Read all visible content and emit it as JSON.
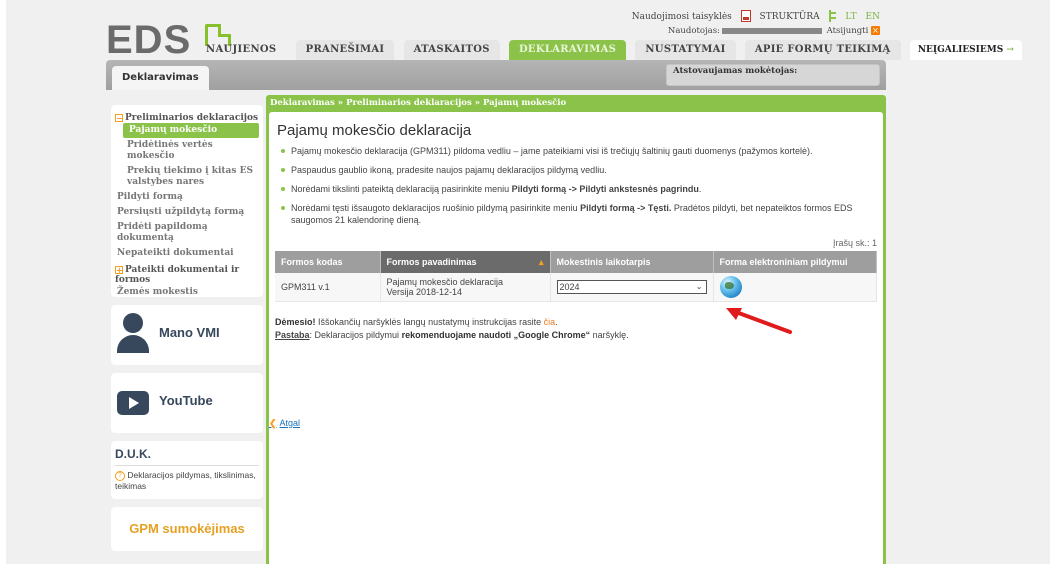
{
  "header": {
    "logo": "EDS",
    "top_links": {
      "rules": "Naudojimosi taisyklės",
      "structure": "STRUKTŪRA",
      "lang_lt": "LT",
      "lang_en": "EN"
    },
    "user_label": "Naudotojas:",
    "logout": "Atsijungti"
  },
  "nav": {
    "items": [
      "NAUJIENOS",
      "PRANEŠIMAI",
      "ATASKAITOS",
      "DEKLARAVIMAS",
      "NUSTATYMAI",
      "APIE FORMŲ TEIKIMĄ"
    ],
    "accessibility": "NEĮGALIESIEMS",
    "subtab": "Deklaravimas",
    "agent_label": "Atstovaujamas mokėtojas:"
  },
  "sidebar": {
    "group1": "Preliminarios deklaracijos",
    "group1_items": [
      "Pajamų mokesčio",
      "Pridėtinės vertės mokesčio",
      "Prekių tiekimo į kitas ES valstybes nares"
    ],
    "items": [
      "Pildyti formą",
      "Persiųsti užpildytą formą",
      "Pridėti papildomą dokumentą",
      "Nepateikti dokumentai"
    ],
    "group2": "Pateikti dokumentai ir formos",
    "item_last": "Žemės mokestis",
    "mano_vmi": "Mano VMI",
    "youtube": "YouTube",
    "duk_title": "D.U.K.",
    "duk_link": "Deklaracijos pildymas, tikslinimas, teikimas",
    "gpm": "GPM sumokėjimas"
  },
  "main": {
    "breadcrumb": "Deklaravimas » Preliminarios deklaracijos » Pajamų mokesčio",
    "title": "Pajamų mokesčio deklaracija",
    "bullets": {
      "b1": "Pajamų mokesčio deklaracija (GPM311) pildoma vedliu – jame pateikiami visi iš trečiųjų šaltinių gauti duomenys (pažymos kortelė).",
      "b2": "Paspaudus gaublio ikoną, pradesite naujos pajamų deklaracijos pildymą vedliu.",
      "b3_pre": "Norėdami tikslinti pateiktą deklaraciją pasirinkite meniu ",
      "b3_bold": "Pildyti formą -> Pildyti ankstesnės pagrindu",
      "b3_post": ".",
      "b4_pre": "Norėdami tęsti išsaugoto deklaracijos ruošinio pildymą pasirinkite meniu ",
      "b4_bold": "Pildyti formą -> Tęsti.",
      "b4_post": " Pradėtos pildyti, bet nepateiktos formos EDS saugomos 21 kalendorinę dieną."
    },
    "record_count": "Įrašų sk.: 1",
    "table": {
      "headers": [
        "Formos kodas",
        "Formos pavadinimas",
        "Mokestinis laikotarpis",
        "Forma elektroniniam pildymui"
      ],
      "row": {
        "code": "GPM311 v.1",
        "name": "Pajamų mokesčio deklaracija",
        "version": "Versija 2018-12-14",
        "period": "2024"
      }
    },
    "notice": {
      "attention_label": "Dėmesio!",
      "attention_text": " Iššokančių naršyklės langų nustatymų instrukcijas rasite ",
      "attention_link": "čia",
      "attention_end": ".",
      "note_label": "Pastaba",
      "note_text": ": Deklaracijos pildymui ",
      "note_bold": "rekomenduojame naudoti „Google Chrome“",
      "note_end": " naršyklę."
    },
    "back": "Atgal"
  },
  "colors": {
    "accent": "#8bc34a",
    "highlight_arrow": "#e01b1b",
    "link_orange": "#e67e22"
  }
}
